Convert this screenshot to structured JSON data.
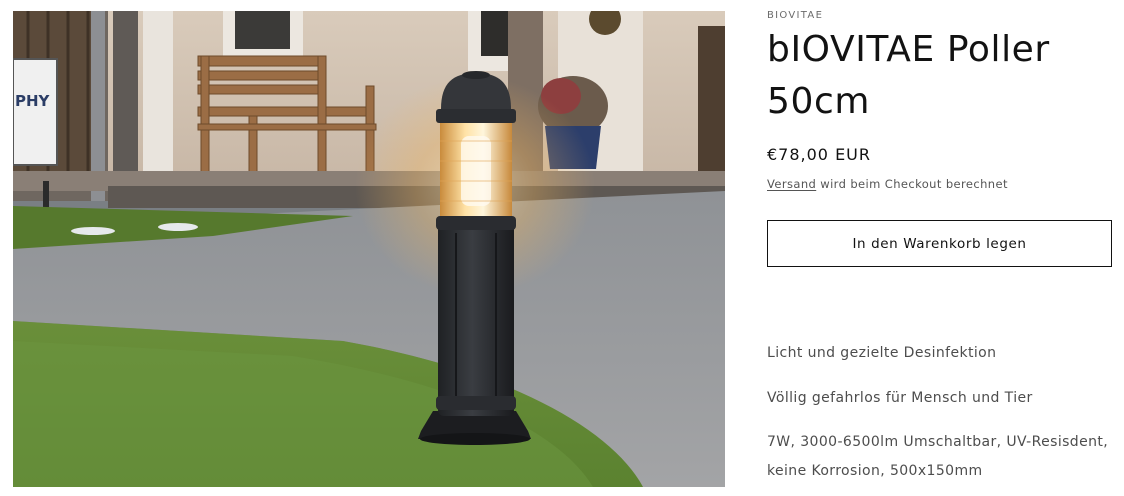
{
  "product": {
    "vendor": "BIOVITAE",
    "title": "bIOVITAE Poller 50cm",
    "price": "€78,00 EUR",
    "shipping_link": "Versand",
    "shipping_note": " wird beim Checkout berechnet",
    "add_to_cart_label": "In den Warenkorb legen",
    "description": [
      "Licht und gezielte Desinfektion",
      "Völlig gefahrlos für Mensch und Tier",
      "7W, 3000-6500lm Umschaltbar, UV-Resisdent,",
      "keine Korrosion, 500x150mm"
    ]
  },
  "photo": {
    "sign_text": "PHY",
    "subject": "bollard-lamp"
  },
  "colors": {
    "text": "#121212",
    "muted": "#555555",
    "button_border": "#121212"
  }
}
